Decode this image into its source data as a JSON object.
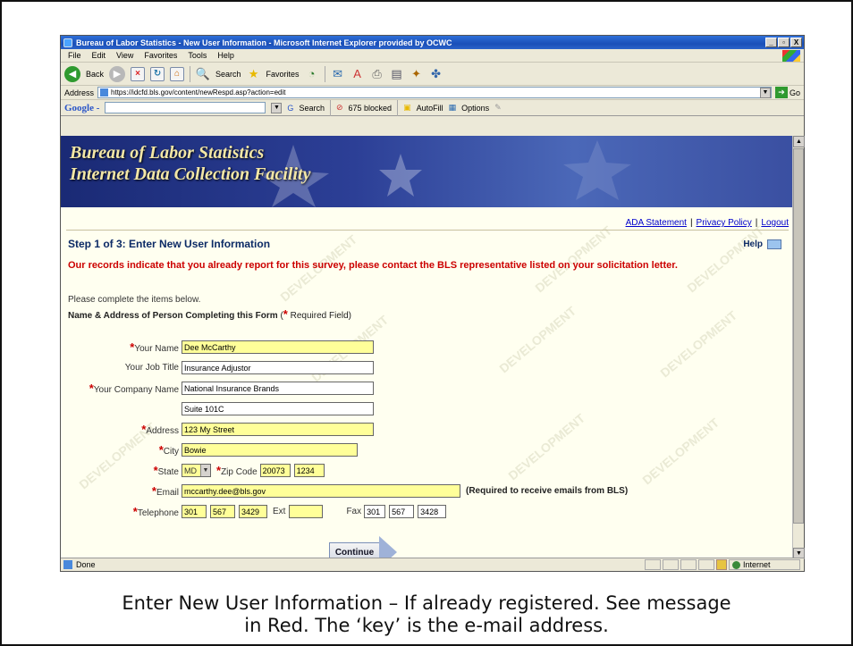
{
  "window": {
    "title": "Bureau of Labor Statistics - New User Information - Microsoft Internet Explorer provided by OCWC",
    "controls": [
      "_",
      "▫",
      "X"
    ]
  },
  "menu": [
    "File",
    "Edit",
    "View",
    "Favorites",
    "Tools",
    "Help"
  ],
  "toolbar": {
    "back_label": "Back",
    "search_label": "Search",
    "favorites_label": "Favorites"
  },
  "address": {
    "label": "Address",
    "url": "https://idcfd.bls.gov/content/newRespd.asp?action=edit",
    "go_label": "Go"
  },
  "googlebar": {
    "logo": "Google -",
    "search_label": "Search",
    "blocked_label": "675 blocked",
    "autofill_label": "AutoFill",
    "options_label": "Options"
  },
  "banner": {
    "line1": "Bureau of Labor Statistics",
    "line2": "Internet Data Collection Facility"
  },
  "links": {
    "ada": "ADA Statement",
    "privacy": "Privacy Policy",
    "logout": "Logout"
  },
  "page": {
    "step_title": "Step 1 of 3: Enter New User Information",
    "help_label": "Help",
    "error": "Our records indicate that you already report for this survey, please contact the BLS representative listed on your solicitation letter.",
    "instructions": "Please complete the items below.",
    "section_heading": "Name & Address of Person Completing this Form",
    "required_note": "Required Field)",
    "required_open": "(",
    "watermark": "DEVELOPMENT"
  },
  "form": {
    "name": {
      "label": "Your Name",
      "value": "Dee McCarthy"
    },
    "job_title": {
      "label": "Your Job Title",
      "value": "Insurance Adjustor"
    },
    "company": {
      "label": "Your Company Name",
      "value": "National Insurance Brands",
      "value2": "Suite 101C"
    },
    "address": {
      "label": "Address",
      "value": "123 My Street"
    },
    "city": {
      "label": "City",
      "value": "Bowie"
    },
    "state": {
      "label": "State",
      "value": "MD"
    },
    "zip": {
      "label": "Zip Code",
      "value": "20073",
      "ext": "1234"
    },
    "email": {
      "label": "Email",
      "value": "mccarthy.dee@bls.gov",
      "note": "(Required to receive emails from BLS)"
    },
    "telephone": {
      "label": "Telephone",
      "area": "301",
      "prefix": "567",
      "line": "3429",
      "ext_label": "Ext",
      "ext": ""
    },
    "fax": {
      "label": "Fax",
      "area": "301",
      "prefix": "567",
      "line": "3428"
    },
    "continue_label": "Continue"
  },
  "status": {
    "text": "Done",
    "zone": "Internet"
  },
  "caption": {
    "line1": "Enter New User Information – If already registered.  See message",
    "line2": "in Red.  The ‘key’ is the e-mail address."
  }
}
